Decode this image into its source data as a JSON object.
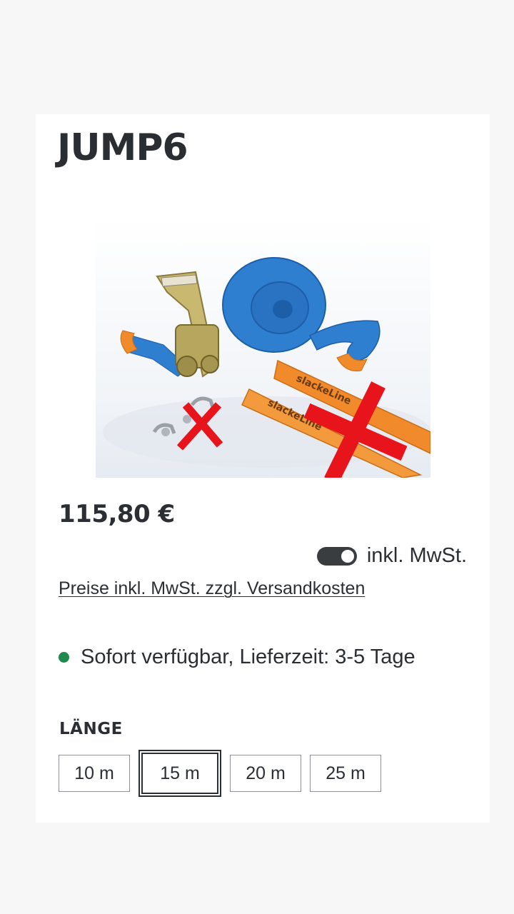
{
  "product": {
    "title": "JUMP6",
    "price": "115,80 €",
    "image_alt": "Slackline set with ratchet, blue webbing, shackles and orange tree protectors"
  },
  "tax": {
    "toggle_label": "inkl. MwSt.",
    "toggle_on": true,
    "shipping_link": "Preise inkl. MwSt. zzgl. Versandkosten"
  },
  "availability": {
    "text": "Sofort verfügbar, Lieferzeit: 3-5 Tage",
    "status_color": "#1f8a4c"
  },
  "length": {
    "label": "LÄNGE",
    "selected": "15 m",
    "options": [
      "10 m",
      "15 m",
      "20 m",
      "25 m"
    ]
  },
  "colors": {
    "webbing": "#2f7fd0",
    "protector": "#f08a2a",
    "cross": "#e8141b"
  }
}
